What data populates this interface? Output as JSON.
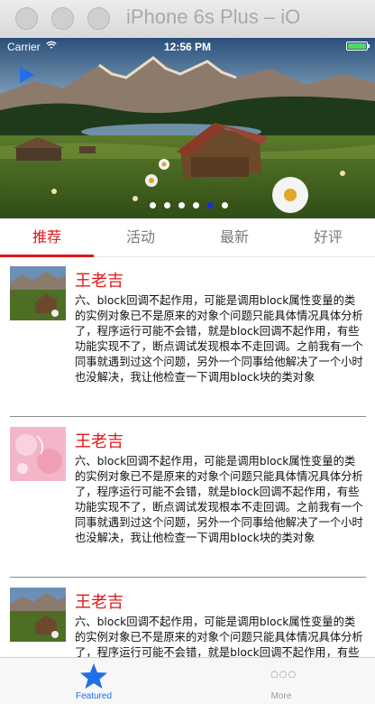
{
  "window": {
    "title": "iPhone 6s Plus – iO"
  },
  "status_bar": {
    "carrier": "Carrier",
    "time": "12:56 PM"
  },
  "icons": {
    "wifi": "wifi-icon",
    "battery": "battery-icon",
    "play": "play-icon",
    "star": "star-icon",
    "more": "more-icon"
  },
  "colors": {
    "accent": "#e01818",
    "tab_selected": "#1f6fe8",
    "page_dot_active": "#1a2fd8"
  },
  "banner": {
    "pages": 6,
    "current_page": 5
  },
  "tabs": [
    {
      "label": "推荐",
      "selected": true
    },
    {
      "label": "活动",
      "selected": false
    },
    {
      "label": "最新",
      "selected": false
    },
    {
      "label": "好评",
      "selected": false
    }
  ],
  "list": [
    {
      "name": "王老吉",
      "thumb": "landscape",
      "desc": "六、block回调不起作用，可能是调用block属性变量的类的实例对象已不是原来的对象个问题只能具体情况具体分析了，程序运行可能不会错，就是block回调不起作用，有些功能实现不了，断点调试发现根本不走回调。之前我有一个同事就遇到过这个问题，另外一个同事给他解决了一个小时也没解决，我让他检查一下调用block块的类对象"
    },
    {
      "name": "王老吉",
      "thumb": "pink-pattern",
      "desc": "六、block回调不起作用，可能是调用block属性变量的类的实例对象已不是原来的对象个问题只能具体情况具体分析了，程序运行可能不会错，就是block回调不起作用，有些功能实现不了，断点调试发现根本不走回调。之前我有一个同事就遇到过这个问题，另外一个同事给他解决了一个小时也没解决，我让他检查一下调用block块的类对象"
    },
    {
      "name": "王老吉",
      "thumb": "landscape",
      "desc": "六、block回调不起作用，可能是调用block属性变量的类的实例对象已不是原来的对象个问题只能具体情况具体分析了，程序运行可能不会错，就是block回调不起作用，有些功能实现不了，断点调试发现根本不走回调。之前我有一个同事就遇到过这个问题，另外一个同事给他解决了一个小时也没解决，我让他检查一下调用block块的类对象"
    }
  ],
  "tabbar": {
    "items": [
      {
        "label": "Featured",
        "selected": true
      },
      {
        "label": "More",
        "selected": false
      }
    ]
  }
}
